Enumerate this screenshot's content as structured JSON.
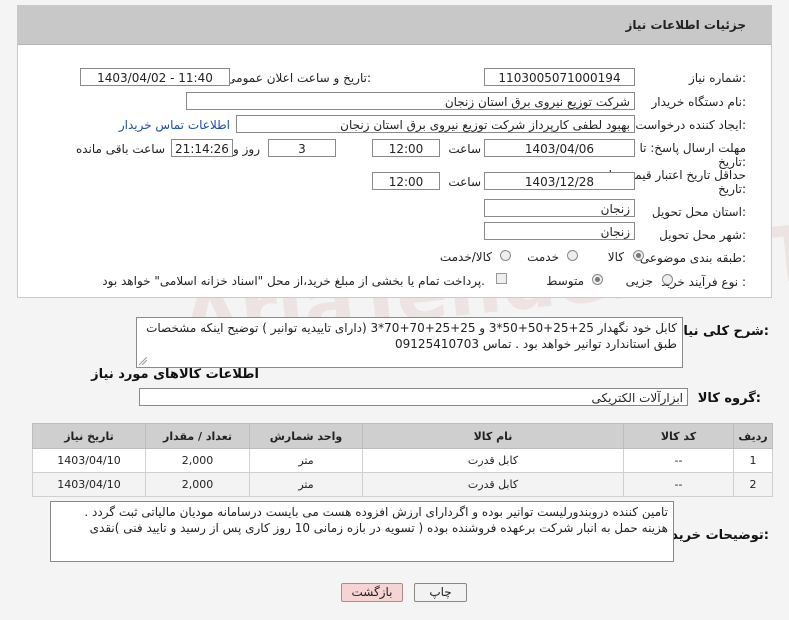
{
  "title": "جزئیات اطلاعات نیاز",
  "fields": {
    "need_number_label": "شماره نیاز:",
    "need_number": "1103005071000194",
    "announce_label": "تاریخ و ساعت اعلان عمومی:",
    "announce_value": "1403/04/02 - 11:40",
    "buyer_org_label": "نام دستگاه خریدار:",
    "buyer_org": "شرکت توزیع نیروی برق استان زنجان",
    "creator_label": "ایجاد کننده درخواست:",
    "creator": "بهبود لطفی کارپرداز شرکت توزیع نیروی برق استان زنجان",
    "contact_link": "اطلاعات تماس خریدار",
    "deadline_label_1": "مهلت ارسال پاسخ: تا",
    "deadline_label_2": "تاریخ:",
    "deadline_date": "1403/04/06",
    "time_label": "ساعت",
    "deadline_time": "12:00",
    "days_value": "3",
    "days_label": "روز و",
    "remaining_time": "21:14:26",
    "remaining_label": "ساعت باقی مانده",
    "price_valid_label_1": "حداقل تاریخ اعتبار قیمت: تا",
    "price_valid_label_2": "تاریخ:",
    "price_valid_date": "1403/12/28",
    "price_valid_time": "12:00",
    "province_label": "استان محل تحویل:",
    "province": "زنجان",
    "city_label": "شهر محل تحویل:",
    "city": "زنجان",
    "category_label": "طبقه بندی موضوعی:",
    "category_options": [
      "کالا",
      "خدمت",
      "کالا/خدمت"
    ],
    "process_label": "نوع فرآیند خرید :",
    "process_options": [
      "جزیی",
      "متوسط"
    ],
    "payment_note": "پرداخت تمام یا بخشی از مبلغ خرید،از محل \"اسناد خزانه اسلامی\" خواهد بود."
  },
  "summary": {
    "label": "شرح کلی نیاز:",
    "text": "کابل خود نگهدار 25+25+50+50*3 و 25+25+70+70*3 (دارای تاییدیه توانیر ) توضیح اینکه مشخصات طبق استاندارد توانیر خواهد بود . تماس 09125410703"
  },
  "items_title": "اطلاعات کالاهای مورد نیاز",
  "goods_group": {
    "label": "گروه کالا:",
    "value": "ابزارآلات الکتریکی"
  },
  "table": {
    "headers": [
      "ردیف",
      "کد کالا",
      "نام کالا",
      "واحد شمارش",
      "تعداد / مقدار",
      "تاریخ نیاز"
    ],
    "rows": [
      [
        "1",
        "--",
        "کابل قدرت",
        "متر",
        "2,000",
        "1403/04/10"
      ],
      [
        "2",
        "--",
        "کابل قدرت",
        "متر",
        "2,000",
        "1403/04/10"
      ]
    ]
  },
  "buyer_notes": {
    "label": "توضیحات خریدار:",
    "text": "تامین کننده دروبندورلیست توانیر بوده و اگردارای ارزش افزوده هست می بایست درسامانه مودیان مالیاتی ثبت گردد . هزینه حمل به انبار شرکت برعهده فروشنده بوده ( تسویه در بازه زمانی 10 روز کاری پس از رسید و تایید فنی )نقدی"
  },
  "buttons": {
    "print": "چاپ",
    "back": "بازگشت"
  },
  "colors": {
    "link": "#1a4fa8",
    "back_button_bg": "#f6d4d4",
    "header_bg": "#c8c8c8"
  }
}
